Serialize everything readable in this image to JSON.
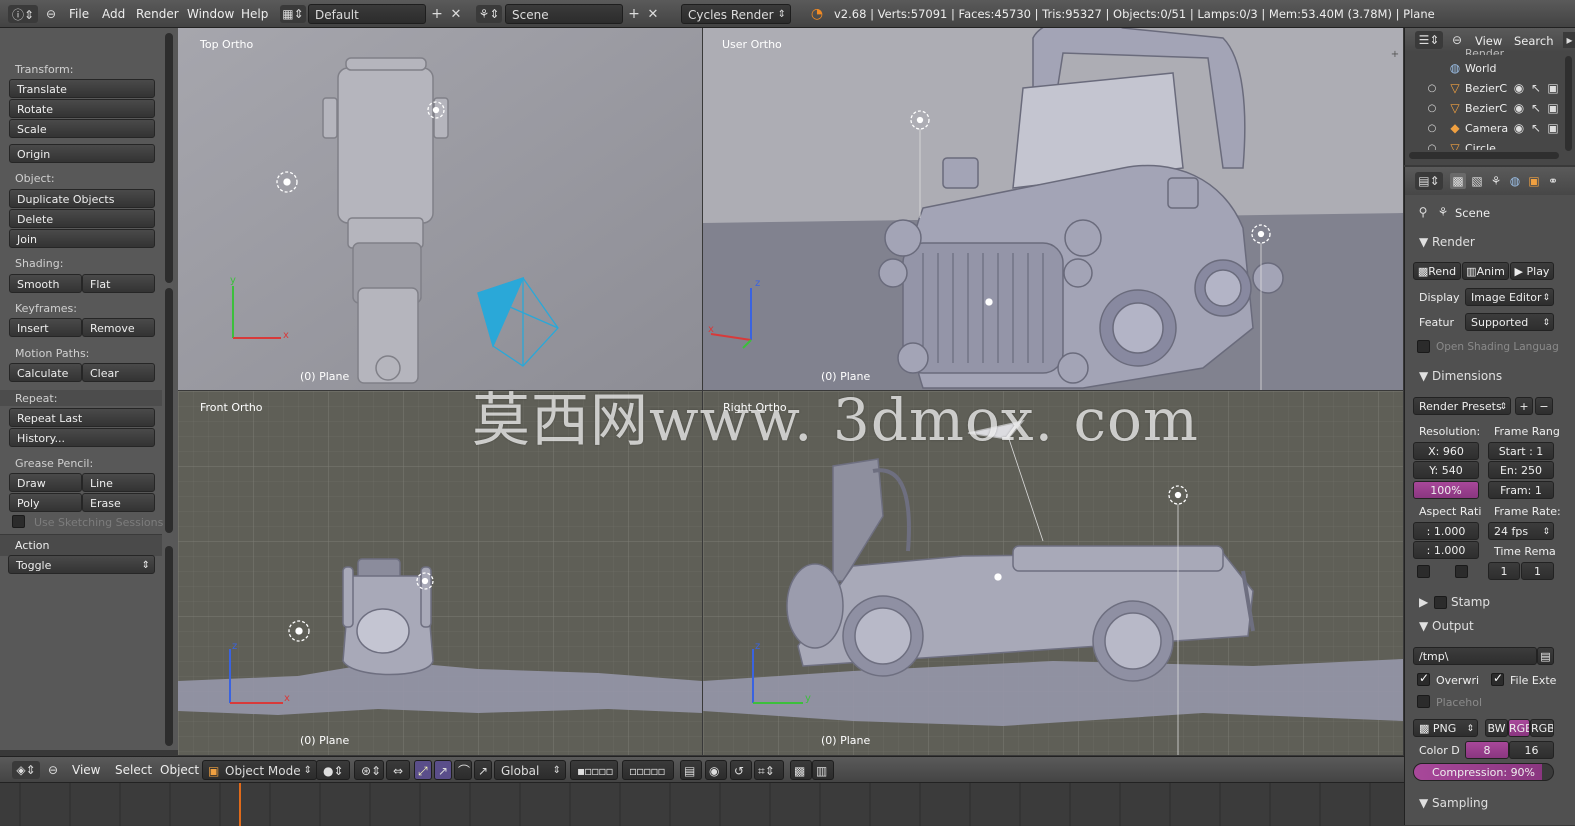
{
  "topbar": {
    "menus": [
      "File",
      "Add",
      "Render",
      "Window",
      "Help"
    ],
    "layout": "Default",
    "scene": "Scene",
    "engine": "Cycles Render",
    "stats": "v2.68 | Verts:57091 | Faces:45730 | Tris:95327 | Objects:0/51 | Lamps:0/3 | Mem:53.40M (3.78M) | Plane"
  },
  "toolshelf": {
    "transform_label": "Transform:",
    "translate": "Translate",
    "rotate": "Rotate",
    "scale": "Scale",
    "origin": "Origin",
    "object_label": "Object:",
    "duplicate": "Duplicate Objects",
    "delete": "Delete",
    "join": "Join",
    "shading_label": "Shading:",
    "smooth": "Smooth",
    "flat": "Flat",
    "keyframes_label": "Keyframes:",
    "insert": "Insert",
    "remove": "Remove",
    "motion_label": "Motion Paths:",
    "calculate": "Calculate",
    "clear": "Clear",
    "repeat_label": "Repeat:",
    "repeat_last": "Repeat Last",
    "history": "History...",
    "grease_label": "Grease Pencil:",
    "draw": "Draw",
    "line": "Line",
    "poly": "Poly",
    "erase": "Erase",
    "sketching": "Use Sketching Sessions",
    "action_label": "Action",
    "toggle": "Toggle"
  },
  "viewports": {
    "top": {
      "label": "Top Ortho",
      "foot": "(0) Plane"
    },
    "user": {
      "label": "User Ortho",
      "foot": "(0) Plane"
    },
    "front": {
      "label": "Front Ortho",
      "foot": "(0) Plane"
    },
    "right": {
      "label": "Right Ortho",
      "foot": "(0) Plane"
    }
  },
  "watermark": "莫西网www. 3dmox. com",
  "bottombar": {
    "view": "View",
    "select": "Select",
    "object": "Object",
    "mode": "Object Mode",
    "orientation": "Global"
  },
  "outliner": {
    "view": "View",
    "search": "Search",
    "cut_item": "Render",
    "items": [
      "World",
      "BezierC",
      "BezierC",
      "Camera",
      "Circle"
    ]
  },
  "properties": {
    "scene": "Scene",
    "render_header": "Render",
    "render_btn": "Rend",
    "anim_btn": "Anim",
    "play_btn": "Play",
    "display_label": "Display",
    "display_value": "Image Editor",
    "feature_label": "Featur",
    "feature_value": "Supported",
    "osl": "Open Shading Languag",
    "dimensions_header": "Dimensions",
    "presets": "Render Presets",
    "resolution_label": "Resolution:",
    "frame_range_label": "Frame Rang",
    "res_x": "X: 960",
    "res_y": "Y: 540",
    "res_pct": "100%",
    "start": "Start : 1",
    "end": "En: 250",
    "step": "Fram: 1",
    "aspect_label": "Aspect Rati",
    "frame_rate_label": "Frame Rate:",
    "aspect_x": ": 1.000",
    "aspect_y": ": 1.000",
    "fps": "24 fps",
    "time_remap_label": "Time Rema",
    "remap_old": "1",
    "remap_new": "1",
    "stamp_header": "Stamp",
    "output_header": "Output",
    "path": "/tmp\\",
    "overwrite": "Overwri",
    "file_ext": "File Exte",
    "placeholders": "Placehol",
    "format": "PNG",
    "bw": "BW",
    "rgb": "RGB",
    "rgba": "RGB",
    "color_depth_label": "Color D",
    "depth_8": "8",
    "depth_16": "16",
    "compression": "Compression: 90%",
    "sampling_header": "Sampling"
  },
  "colors": {
    "accent_purple": "#9b3f8c",
    "axis_red": "#d83a3a",
    "axis_green": "#3cbf3c",
    "axis_blue": "#3a63e0",
    "camera_cyan": "#2aa8d8",
    "playhead": "#e06a1a"
  }
}
